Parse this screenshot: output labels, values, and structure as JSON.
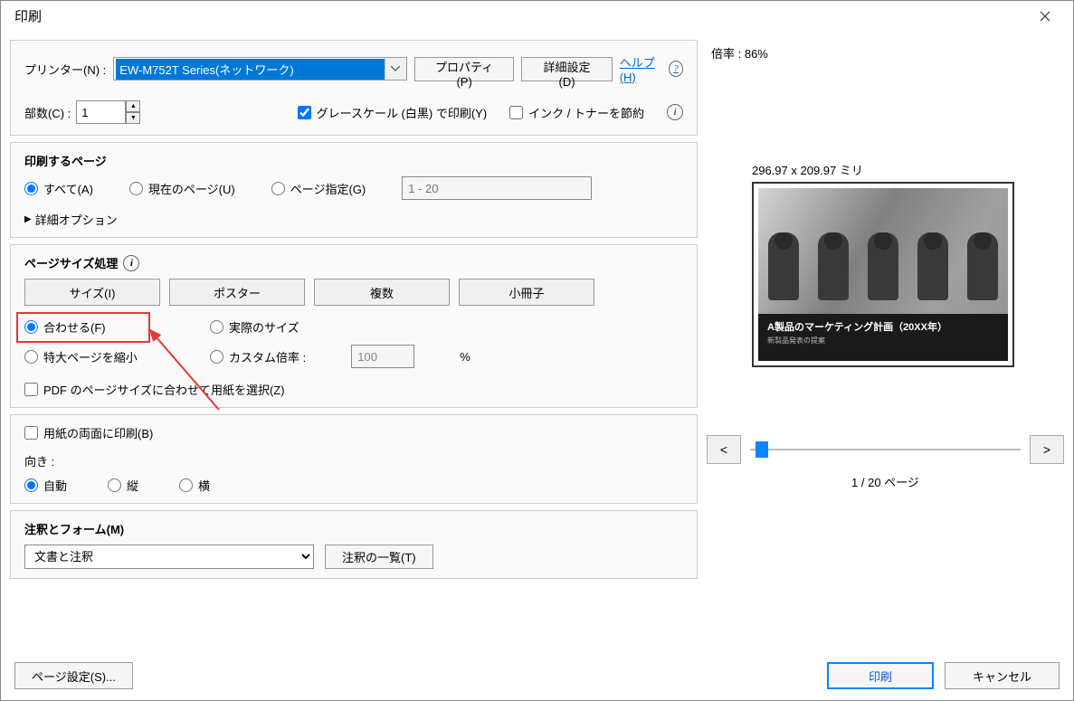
{
  "title": "印刷",
  "top": {
    "printer_label": "プリンター(N) :",
    "printer_value": "EW-M752T Series(ネットワーク)",
    "properties_btn": "プロパティ(P)",
    "advanced_btn": "詳細設定(D)",
    "help_link": "ヘルプ(H)",
    "copies_label": "部数(C) :",
    "copies_value": "1",
    "grayscale_label": "グレースケール (白黒) で印刷(Y)",
    "save_ink_label": "インク / トナーを節約"
  },
  "pages": {
    "title": "印刷するページ",
    "all": "すべて(A)",
    "current": "現在のページ(U)",
    "range": "ページ指定(G)",
    "range_placeholder": "1 - 20",
    "more": "詳細オプション"
  },
  "sizing": {
    "title": "ページサイズ処理",
    "tabs": {
      "size": "サイズ(I)",
      "poster": "ポスター",
      "multi": "複数",
      "booklet": "小冊子"
    },
    "fit": "合わせる(F)",
    "actual": "実際のサイズ",
    "shrink": "特大ページを縮小",
    "custom": "カスタム倍率 :",
    "custom_value": "100",
    "percent": "%",
    "paper_match": "PDF のページサイズに合わせて用紙を選択(Z)"
  },
  "duplex": {
    "label": "用紙の両面に印刷(B)"
  },
  "orient": {
    "label": "向き :",
    "auto": "自動",
    "portrait": "縦",
    "landscape": "横"
  },
  "comments": {
    "title": "注釈とフォーム(M)",
    "value": "文書と注釈",
    "summary_btn": "注釈の一覧(T)"
  },
  "footer": {
    "page_setup": "ページ設定(S)...",
    "print": "印刷",
    "cancel": "キャンセル"
  },
  "preview": {
    "scale_label": "倍率 : 86%",
    "dims": "296.97 x 209.97 ミリ",
    "doc_title": "A製品のマーケティング計画（20XX年）",
    "doc_sub": "新製品発表の提案",
    "prev": "<",
    "next": ">",
    "counter": "1 / 20 ページ"
  }
}
